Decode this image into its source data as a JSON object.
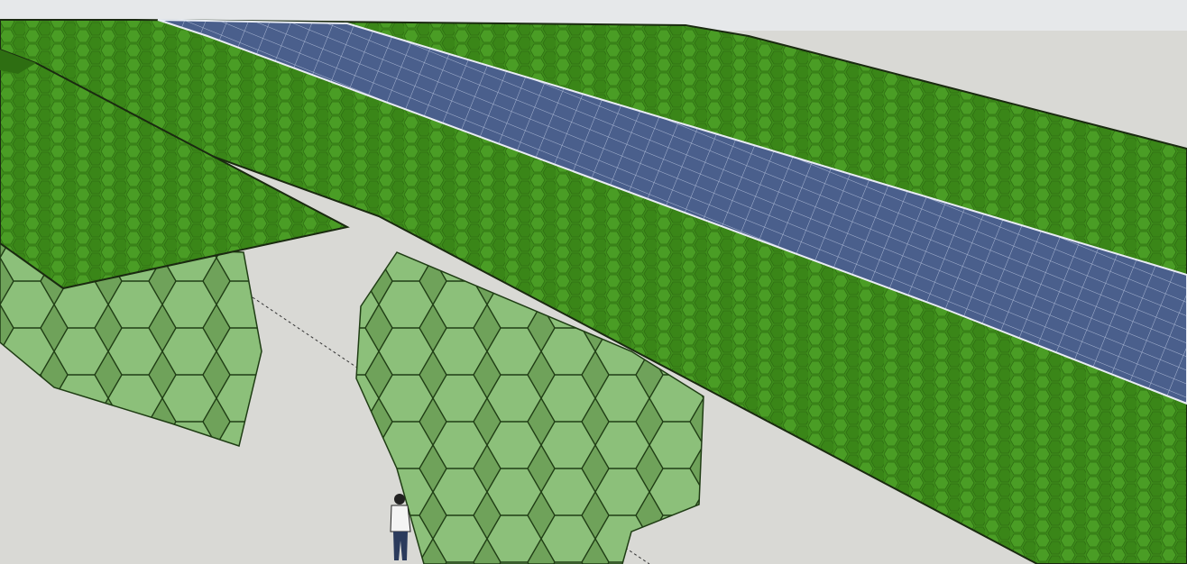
{
  "app": {
    "type": "3d-model-viewport",
    "colors": {
      "sky": "#e6e8ea",
      "ground": "#d9d9d5",
      "green_roof": "#3f8f1c",
      "green_roof_dark": "#2e6e12",
      "solar_panel": "#4a5f8c",
      "solar_grid": "#a9b6d3",
      "hex_fill": "#7fb36a",
      "hex_stroke": "#1f3d14",
      "edge": "#1a2a10"
    }
  },
  "scene": {
    "objects": [
      {
        "name": "green-roof-canopy",
        "icon": "hex-texture"
      },
      {
        "name": "solar-panel-strip",
        "icon": "solar-grid"
      },
      {
        "name": "left-canopy-wing",
        "icon": "hex-texture"
      },
      {
        "name": "hex-column-left",
        "icon": "hexagon"
      },
      {
        "name": "hex-column-center",
        "icon": "hexagon"
      },
      {
        "name": "scale-figure",
        "icon": "person-icon"
      },
      {
        "name": "guide-line",
        "icon": "dashed-line"
      }
    ]
  }
}
